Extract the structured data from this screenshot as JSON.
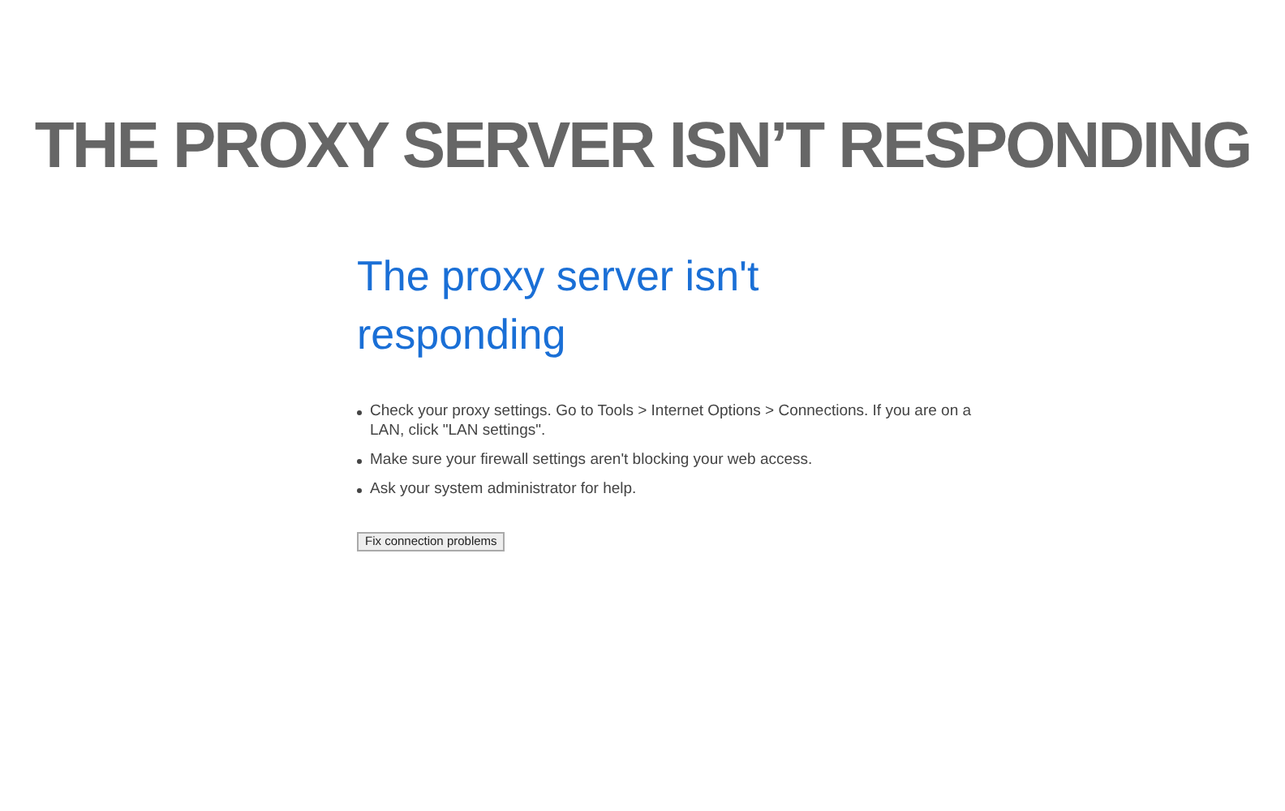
{
  "banner": {
    "title": "THE PROXY SERVER ISN’T RESPONDING"
  },
  "error_page": {
    "heading": "The proxy server isn't responding",
    "tips": [
      "Check your proxy settings. Go to Tools > Internet Options > Connections. If you are on a LAN, click \"LAN settings\".",
      "Make sure your firewall settings aren't blocking your web access.",
      "Ask your system administrator for help."
    ],
    "button": "Fix connection problems"
  }
}
